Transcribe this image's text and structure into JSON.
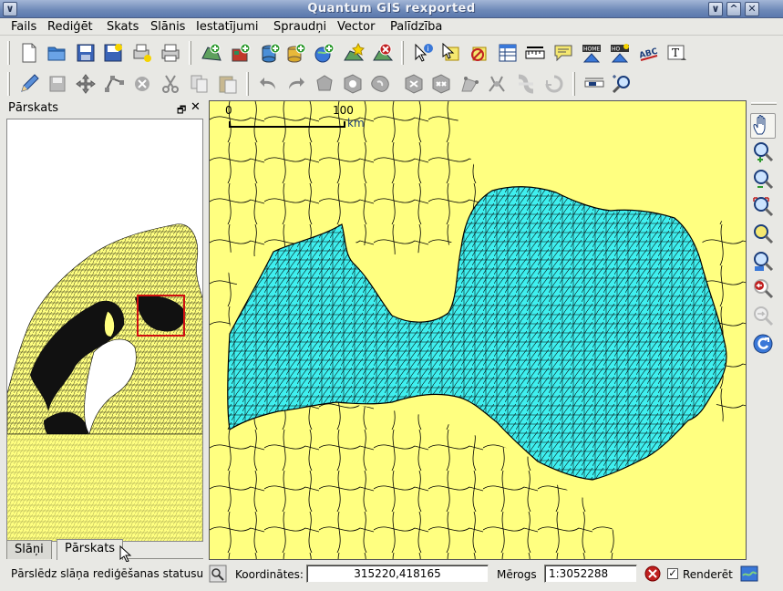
{
  "window": {
    "title": "Quantum GIS rexported",
    "buttons": [
      "∨",
      "^",
      "✕"
    ]
  },
  "menu": [
    "Fails",
    "Rediģēt",
    "Skats",
    "Slānis",
    "Iestatījumi",
    "Spraudņi",
    "Vector",
    "Palīdzība"
  ],
  "toolbar_row1": [
    "new-project-icon",
    "open-project-icon",
    "save-project-icon",
    "save-as-icon",
    "print-composer-icon",
    "print-icon",
    "add-vector-layer-icon",
    "add-raster-layer-icon",
    "add-postgis-layer-icon",
    "add-spatialite-layer-icon",
    "add-wms-layer-icon",
    "new-vector-layer-icon",
    "remove-layer-icon",
    "identify-icon",
    "select-icon",
    "deselect-icon",
    "attribute-table-icon",
    "measure-line-icon",
    "map-tips-icon",
    "home-icon",
    "home-new-icon",
    "label-abc-icon",
    "text-annotation-icon"
  ],
  "toolbar_row2": [
    "toggle-editing-icon",
    "save-edits-icon",
    "move-feature-icon",
    "node-tool-icon",
    "delete-selected-icon",
    "cut-features-icon",
    "copy-features-icon",
    "paste-features-icon",
    "undo-icon",
    "redo-icon",
    "capture-polygon-icon",
    "add-ring-icon",
    "add-part-icon",
    "delete-ring-icon",
    "delete-part-icon",
    "reshape-icon",
    "split-icon",
    "merge-icon",
    "merge-attributes-icon",
    "rotate-icon",
    "gps-icon",
    "zoom-tool-icon"
  ],
  "dock": {
    "title": "Pārskats",
    "float": "🗗",
    "close": "✕"
  },
  "tabs": {
    "layers": "Slāņi",
    "overview": "Pārskats"
  },
  "map": {
    "scalebar_start": "0",
    "scalebar_end": "100",
    "scalebar_unit": "km",
    "background": "#ffff80",
    "highlight": "#3fefef"
  },
  "right_tools": [
    "pan-icon",
    "zoom-in-icon",
    "zoom-out-icon",
    "zoom-full-icon",
    "zoom-selection-icon",
    "zoom-layer-icon",
    "zoom-last-icon",
    "zoom-next-icon",
    "refresh-icon"
  ],
  "status": {
    "message": "Pārslēdz slāņa rediģēšanas statusu",
    "coord_label": "Koordinātes:",
    "coord_value": "315220,418165",
    "scale_label": "Mērogs",
    "scale_value": "1:3052288",
    "render_label": "Renderēt",
    "render_checked": "✓"
  }
}
